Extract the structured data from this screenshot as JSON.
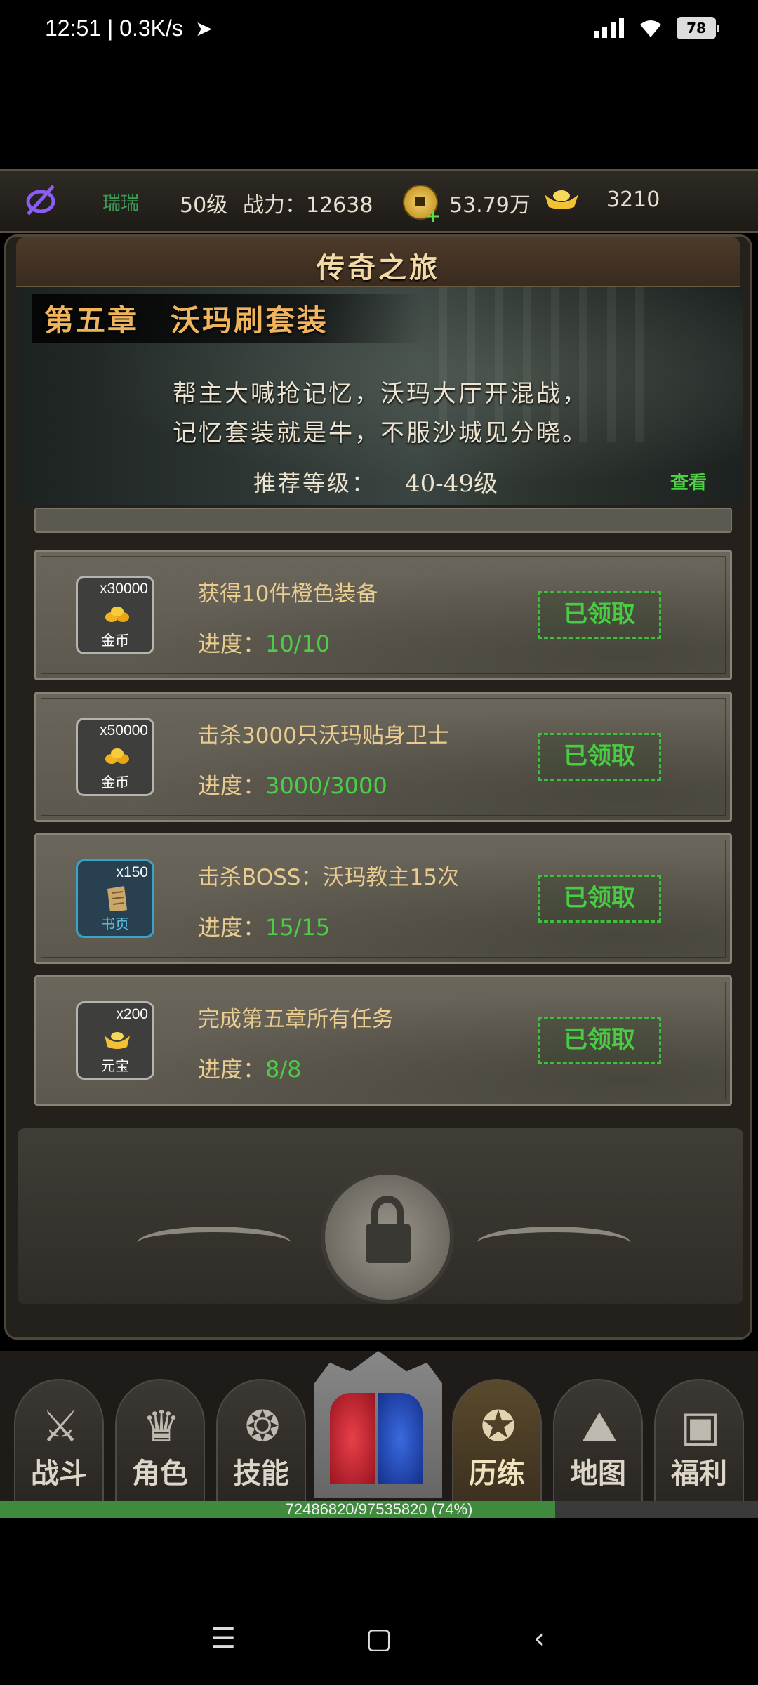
{
  "status": {
    "time": "12:51 | 0.3K/s",
    "battery": "78"
  },
  "resources": {
    "name": "瑞瑞",
    "level": "50级",
    "power": "战力：12638",
    "coins": "53.79万",
    "ingots": "3210"
  },
  "panel": {
    "title": "传奇之旅"
  },
  "chapter": {
    "title": "第五章　沃玛刷套装",
    "desc_line1": "帮主大喊抢记忆，沃玛大厅开混战，",
    "desc_line2": "记忆套装就是牛，不服沙城见分晓。",
    "rec_label": "推荐等级：",
    "rec_value": "40-49级",
    "view": "查看"
  },
  "tasks": [
    {
      "qty": "x30000",
      "reward": "金币",
      "title": "获得10件橙色装备",
      "progress_label": "进度：",
      "progress": "10/10",
      "button": "已领取"
    },
    {
      "qty": "x50000",
      "reward": "金币",
      "title": "击杀3000只沃玛贴身卫士",
      "progress_label": "进度：",
      "progress": "3000/3000",
      "button": "已领取"
    },
    {
      "qty": "x150",
      "reward": "书页",
      "title": "击杀BOSS：沃玛教主15次",
      "progress_label": "进度：",
      "progress": "15/15",
      "button": "已领取"
    },
    {
      "qty": "x200",
      "reward": "元宝",
      "title": "完成第五章所有任务",
      "progress_label": "进度：",
      "progress": "8/8",
      "button": "已领取"
    }
  ],
  "nav": [
    {
      "label": "战斗",
      "icon": "swords-icon"
    },
    {
      "label": "角色",
      "icon": "helmet-icon"
    },
    {
      "label": "技能",
      "icon": "skill-icon"
    },
    {
      "label": "历练",
      "icon": "triskelion-icon"
    },
    {
      "label": "地图",
      "icon": "map-icon"
    },
    {
      "label": "福利",
      "icon": "chest-icon"
    }
  ],
  "exp": {
    "text": "72486820/97535820 (74%)",
    "fraction": 0.74
  },
  "colors": {
    "accent_green": "#4ccd46",
    "gold_text": "#e9cc8e"
  }
}
